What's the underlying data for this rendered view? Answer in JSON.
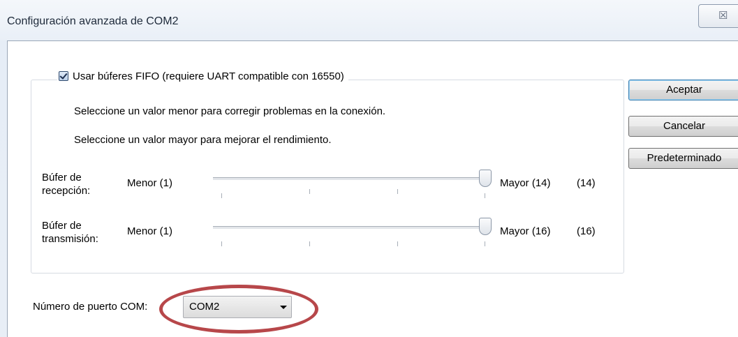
{
  "window": {
    "title": "Configuración avanzada de COM2",
    "close_glyph": "☒"
  },
  "fifo": {
    "checkbox_label": "Usar búferes FIFO (requiere UART compatible con 16550)",
    "checked": true,
    "hint_lower": "Seleccione un valor menor para corregir problemas en la conexión.",
    "hint_higher": "Seleccione un valor mayor para mejorar el rendimiento."
  },
  "receive": {
    "label_line1": "Búfer de",
    "label_line2": "recepción:",
    "min_label": "Menor (1)",
    "max_label": "Mayor (14)",
    "current": "(14)",
    "value": 14,
    "min": 1,
    "max": 14
  },
  "transmit": {
    "label_line1": "Búfer de",
    "label_line2": "transmisión:",
    "min_label": "Menor (1)",
    "max_label": "Mayor (16)",
    "current": "(16)",
    "value": 16,
    "min": 1,
    "max": 16
  },
  "buttons": {
    "accept": "Aceptar",
    "cancel": "Cancelar",
    "default": "Predeterminado"
  },
  "port": {
    "label": "Número de puerto COM:",
    "selected": "COM2"
  },
  "colors": {
    "highlight_ellipse": "#b7474a"
  }
}
